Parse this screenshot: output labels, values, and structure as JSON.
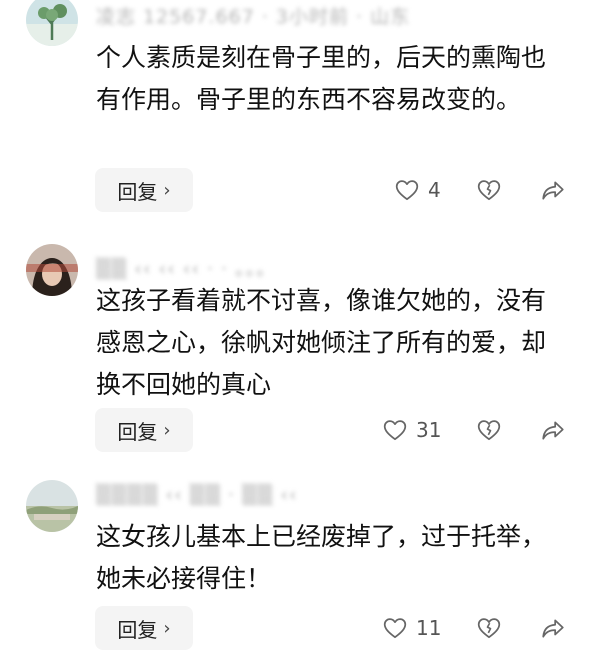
{
  "comments": [
    {
      "meta": "凌志 12567.667 · 3小时前 · 山东",
      "text": "个人素质是刻在骨子里的，后天的熏陶也有作用。骨子里的东西不容易改变的。",
      "reply_label": "回复",
      "likes": "4"
    },
    {
      "meta": "▒▒ ‹‹ ‹‹ ‹‹ ·  · 。。。",
      "text": "这孩子看着就不讨喜，像谁欠她的，没有感恩之心，徐帆对她倾注了所有的爱，却换不回她的真心",
      "reply_label": "回复",
      "likes": "31"
    },
    {
      "meta": "▒▒▒▒ ‹‹ ▒▒ · ▒▒ ‹‹",
      "text": "这女孩儿基本上已经废掉了，过于托举，她未必接得住！",
      "reply_label": "回复",
      "likes": "11"
    }
  ],
  "icons": {
    "like": "heart-outline-icon",
    "dislike": "broken-heart-icon",
    "share": "share-arrow-icon"
  },
  "colors": {
    "text": "#111111",
    "muted": "#b5b5b5",
    "reply_bg": "#f4f4f4",
    "icon": "#666666"
  }
}
